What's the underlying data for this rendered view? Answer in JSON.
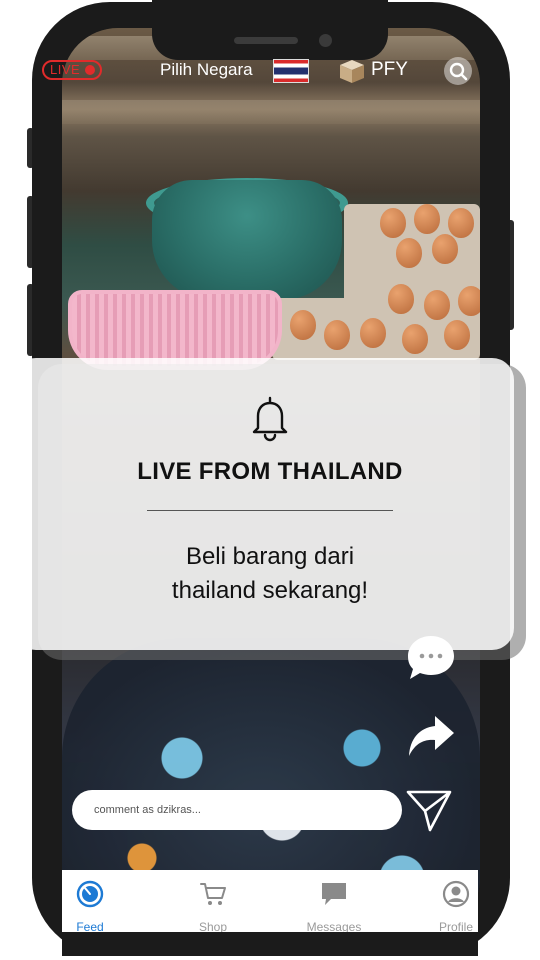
{
  "topbar": {
    "live_label": "LIVE",
    "country_label": "Pilih Negara",
    "brand": "PFY"
  },
  "notification": {
    "title": "LIVE FROM THAILAND",
    "body_line1": "Beli barang dari",
    "body_line2": "thailand sekarang!"
  },
  "comment": {
    "placeholder": "comment as dzikras..."
  },
  "nav": {
    "items": [
      {
        "label": "Feed",
        "icon": "feed-icon",
        "active": true
      },
      {
        "label": "Shop",
        "icon": "cart-icon",
        "active": false
      },
      {
        "label": "Messages",
        "icon": "message-icon",
        "active": false
      },
      {
        "label": "Profile",
        "icon": "profile-icon",
        "active": false
      }
    ]
  },
  "colors": {
    "live_red": "#e12b2b",
    "nav_active": "#1d7ad4",
    "nav_inactive": "#9a9a9a"
  }
}
